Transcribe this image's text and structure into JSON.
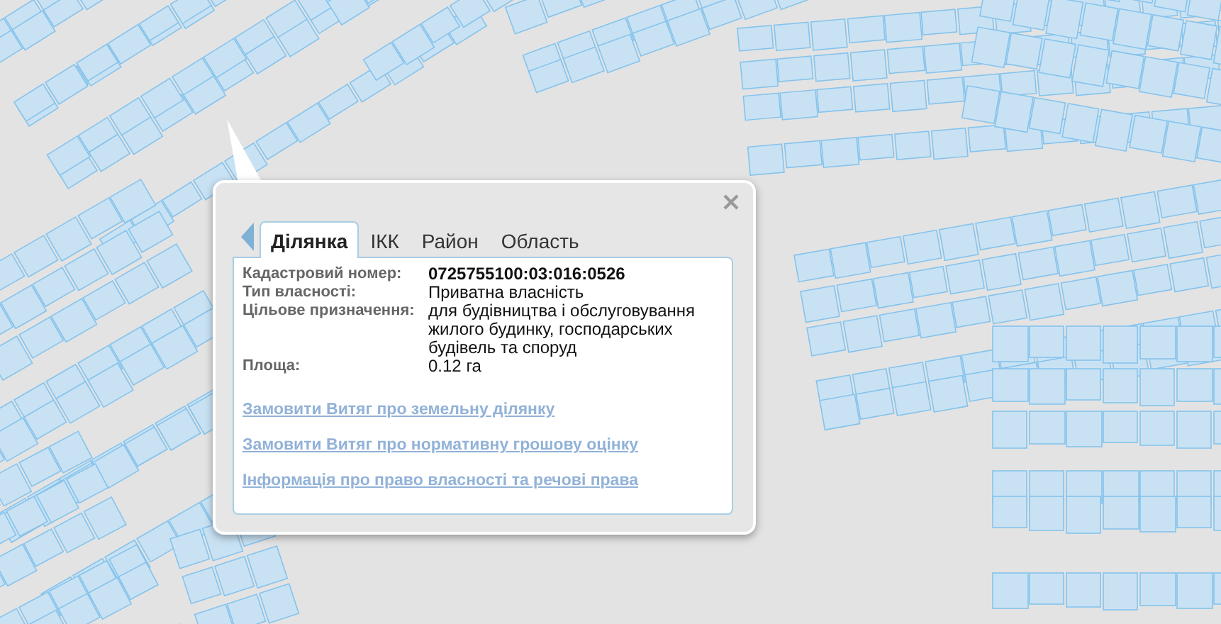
{
  "popup": {
    "tabs": [
      {
        "label": "Ділянка",
        "selected": true
      },
      {
        "label": "ІКК",
        "selected": false
      },
      {
        "label": "Район",
        "selected": false
      },
      {
        "label": "Область",
        "selected": false
      }
    ],
    "fields": [
      {
        "label": "Кадастровий номер:",
        "value": "0725755100:03:016:0526",
        "bold": true
      },
      {
        "label": "Тип власності:",
        "value": "Приватна власність",
        "bold": false
      },
      {
        "label": "Цільове призначення:",
        "value": "для будівництва і обслуговування жилого будинку, господарських будівель та споруд",
        "bold": false
      },
      {
        "label": "Площа:",
        "value": "0.12 га",
        "bold": false
      }
    ],
    "links": [
      "Замовити Витяг про земельну ділянку",
      "Замовити Витяг про нормативну грошову оцінку",
      "Інформація про право власності та речові права"
    ]
  }
}
